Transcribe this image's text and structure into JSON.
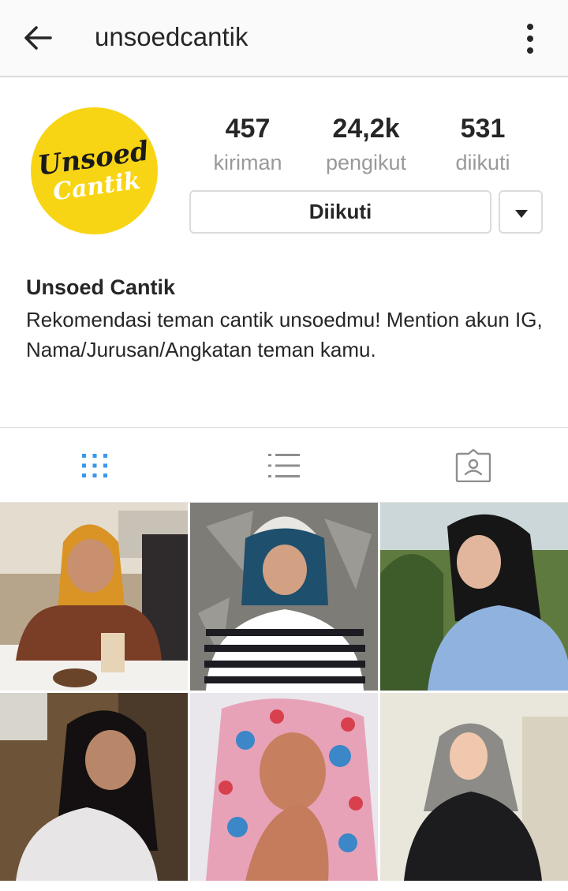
{
  "header": {
    "username": "unsoedcantik",
    "back_icon": "arrow-left-icon",
    "menu_icon": "more-vertical-icon"
  },
  "profile": {
    "avatar_text_line1": "Unsoed",
    "avatar_text_line2": "Cantik",
    "avatar_color": "#f8d514",
    "stats": [
      {
        "value": "457",
        "label": "kiriman"
      },
      {
        "value": "24,2k",
        "label": "pengikut"
      },
      {
        "value": "531",
        "label": "diikuti"
      }
    ],
    "follow_button_label": "Diikuti",
    "dropdown_icon": "caret-down-icon",
    "full_name": "Unsoed Cantik",
    "bio": "Rekomendasi teman cantik unsoedmu! Mention akun IG, Nama/Jurusan/Angkatan teman kamu."
  },
  "tabs": [
    {
      "name": "grid-view",
      "icon": "grid-icon",
      "active": true
    },
    {
      "name": "list-view",
      "icon": "list-icon",
      "active": false
    },
    {
      "name": "tagged-view",
      "icon": "tagged-person-icon",
      "active": false
    }
  ],
  "colors": {
    "accent": "#3897f0",
    "text": "#262626",
    "muted": "#999999",
    "border": "#dbdbdb"
  },
  "posts": [
    {
      "id": "post-1"
    },
    {
      "id": "post-2"
    },
    {
      "id": "post-3"
    },
    {
      "id": "post-4"
    },
    {
      "id": "post-5"
    },
    {
      "id": "post-6"
    }
  ]
}
